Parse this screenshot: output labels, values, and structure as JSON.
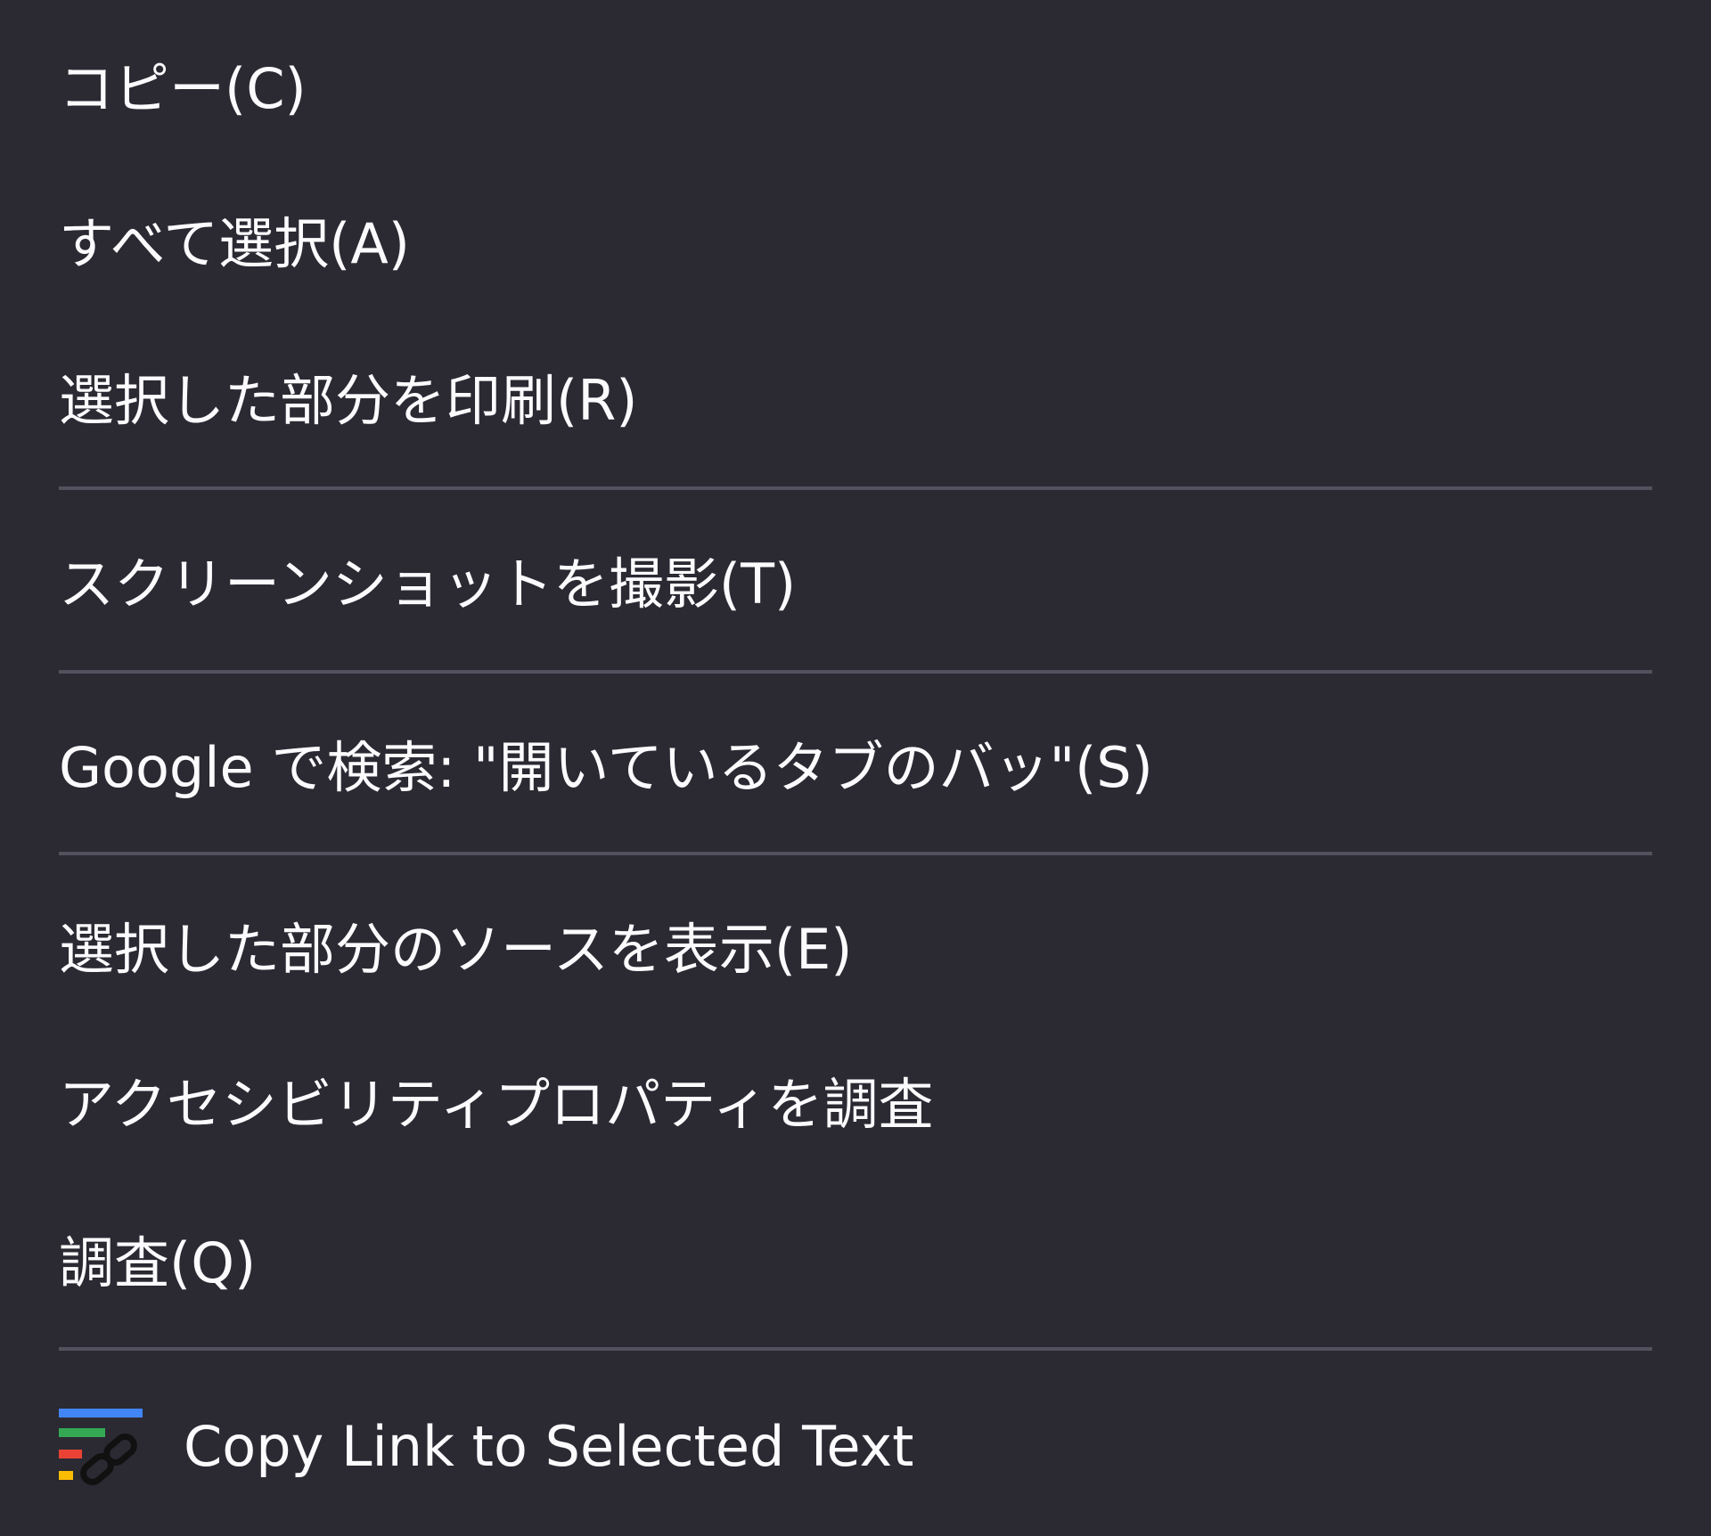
{
  "menu": {
    "items": [
      {
        "label": "コピー(C)"
      },
      {
        "label": "すべて選択(A)"
      },
      {
        "label": "選択した部分を印刷(R)"
      },
      {
        "label": "スクリーンショットを撮影(T)"
      },
      {
        "label": "Google で検索: \"開いているタブのバッ\"(S)"
      },
      {
        "label": "選択した部分のソースを表示(E)"
      },
      {
        "label": "アクセシビリティプロパティを調査"
      },
      {
        "label": "調査(Q)"
      },
      {
        "label": "Copy Link to Selected Text",
        "icon": "link-to-text-icon"
      }
    ]
  },
  "colors": {
    "background": "#2b2a33",
    "text": "#fbfbfe",
    "separator": "#52525e",
    "icon_blue": "#4285f4",
    "icon_green": "#34a853",
    "icon_red": "#ea4335",
    "icon_yellow": "#fbbc04"
  }
}
